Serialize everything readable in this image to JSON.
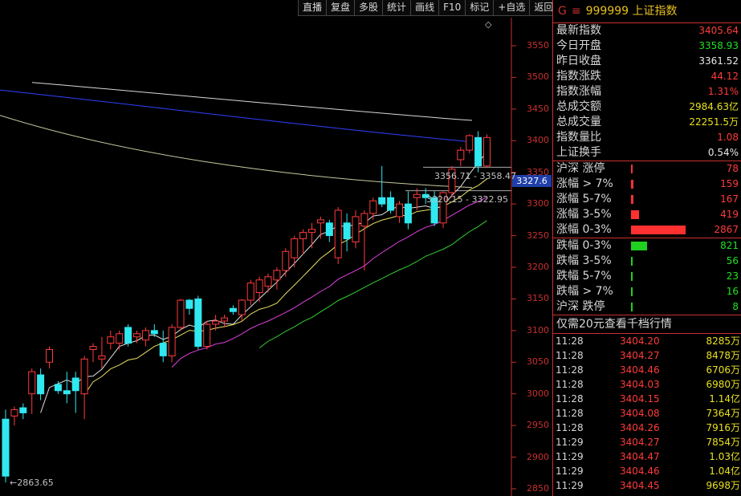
{
  "toolbar": [
    "直播",
    "复盘",
    "多股",
    "统计",
    "画线",
    "F10",
    "标记",
    "+自选",
    "返回"
  ],
  "axis": {
    "ticks": [
      3550,
      3500,
      3450,
      3400,
      3350,
      3300,
      3250,
      3200,
      3150,
      3100,
      3050,
      3000,
      2950,
      2900,
      2850
    ],
    "current_price_tag": "3327.6"
  },
  "annotations": {
    "upper_range": "3356.71 - 3358.47",
    "lower_range": "3320.15 - 3322.95",
    "low_marker": "2863.65"
  },
  "chart_data": {
    "type": "line",
    "candles": [
      {
        "o": 2960,
        "h": 2975,
        "l": 2860,
        "c": 2870
      },
      {
        "o": 2965,
        "h": 2980,
        "l": 2950,
        "c": 2975
      },
      {
        "o": 2978,
        "h": 2985,
        "l": 2960,
        "c": 2970
      },
      {
        "o": 3000,
        "h": 3040,
        "l": 2968,
        "c": 3035
      },
      {
        "o": 3030,
        "h": 3040,
        "l": 2990,
        "c": 3000
      },
      {
        "o": 3050,
        "h": 3075,
        "l": 3040,
        "c": 3070
      },
      {
        "o": 3015,
        "h": 3020,
        "l": 3000,
        "c": 3005
      },
      {
        "o": 3005,
        "h": 3035,
        "l": 2985,
        "c": 3000
      },
      {
        "o": 3025,
        "h": 3035,
        "l": 2970,
        "c": 3005
      },
      {
        "o": 3000,
        "h": 3060,
        "l": 2960,
        "c": 3055
      },
      {
        "o": 3070,
        "h": 3080,
        "l": 3050,
        "c": 3075
      },
      {
        "o": 3055,
        "h": 3090,
        "l": 3040,
        "c": 3060
      },
      {
        "o": 3080,
        "h": 3100,
        "l": 3070,
        "c": 3090
      },
      {
        "o": 3080,
        "h": 3100,
        "l": 3070,
        "c": 3095
      },
      {
        "o": 3105,
        "h": 3110,
        "l": 3075,
        "c": 3080
      },
      {
        "o": 3090,
        "h": 3100,
        "l": 3080,
        "c": 3095
      },
      {
        "o": 3085,
        "h": 3105,
        "l": 3075,
        "c": 3100
      },
      {
        "o": 3100,
        "h": 3110,
        "l": 3090,
        "c": 3095
      },
      {
        "o": 3080,
        "h": 3100,
        "l": 3050,
        "c": 3060
      },
      {
        "o": 3060,
        "h": 3110,
        "l": 3050,
        "c": 3105
      },
      {
        "o": 3105,
        "h": 3150,
        "l": 3100,
        "c": 3148
      },
      {
        "o": 3148,
        "h": 3150,
        "l": 3125,
        "c": 3135
      },
      {
        "o": 3150,
        "h": 3155,
        "l": 3070,
        "c": 3075
      },
      {
        "o": 3075,
        "h": 3115,
        "l": 3070,
        "c": 3110
      },
      {
        "o": 3110,
        "h": 3125,
        "l": 3100,
        "c": 3115
      },
      {
        "o": 3115,
        "h": 3125,
        "l": 3105,
        "c": 3120
      },
      {
        "o": 3135,
        "h": 3140,
        "l": 3125,
        "c": 3130
      },
      {
        "o": 3125,
        "h": 3150,
        "l": 3115,
        "c": 3148
      },
      {
        "o": 3148,
        "h": 3180,
        "l": 3140,
        "c": 3175
      },
      {
        "o": 3160,
        "h": 3185,
        "l": 3145,
        "c": 3180
      },
      {
        "o": 3170,
        "h": 3190,
        "l": 3160,
        "c": 3185
      },
      {
        "o": 3180,
        "h": 3200,
        "l": 3165,
        "c": 3195
      },
      {
        "o": 3195,
        "h": 3230,
        "l": 3185,
        "c": 3225
      },
      {
        "o": 3215,
        "h": 3250,
        "l": 3200,
        "c": 3245
      },
      {
        "o": 3245,
        "h": 3260,
        "l": 3220,
        "c": 3255
      },
      {
        "o": 3255,
        "h": 3270,
        "l": 3230,
        "c": 3260
      },
      {
        "o": 3270,
        "h": 3280,
        "l": 3245,
        "c": 3275
      },
      {
        "o": 3270,
        "h": 3275,
        "l": 3240,
        "c": 3250
      },
      {
        "o": 3215,
        "h": 3295,
        "l": 3205,
        "c": 3290
      },
      {
        "o": 3270,
        "h": 3285,
        "l": 3225,
        "c": 3245
      },
      {
        "o": 3240,
        "h": 3290,
        "l": 3230,
        "c": 3280
      },
      {
        "o": 3265,
        "h": 3290,
        "l": 3195,
        "c": 3285
      },
      {
        "o": 3285,
        "h": 3310,
        "l": 3275,
        "c": 3305
      },
      {
        "o": 3310,
        "h": 3360,
        "l": 3295,
        "c": 3300
      },
      {
        "o": 3310,
        "h": 3320,
        "l": 3285,
        "c": 3290
      },
      {
        "o": 3280,
        "h": 3305,
        "l": 3270,
        "c": 3300
      },
      {
        "o": 3300,
        "h": 3320,
        "l": 3260,
        "c": 3270
      },
      {
        "o": 3310,
        "h": 3325,
        "l": 3290,
        "c": 3315
      },
      {
        "o": 3315,
        "h": 3325,
        "l": 3300,
        "c": 3310
      },
      {
        "o": 3310,
        "h": 3320,
        "l": 3265,
        "c": 3270
      },
      {
        "o": 3270,
        "h": 3320,
        "l": 3262,
        "c": 3318
      },
      {
        "o": 3318,
        "h": 3360,
        "l": 3310,
        "c": 3355
      },
      {
        "o": 3370,
        "h": 3390,
        "l": 3360,
        "c": 3385
      },
      {
        "o": 3385,
        "h": 3410,
        "l": 3380,
        "c": 3408
      },
      {
        "o": 3405,
        "h": 3415,
        "l": 3350,
        "c": 3360
      },
      {
        "o": 3360,
        "h": 3410,
        "l": 3358,
        "c": 3405
      }
    ]
  },
  "panel": {
    "code_prefix": "G",
    "code_sym": "≡",
    "code": "999999",
    "name": "上证指数",
    "quote": [
      {
        "label": "最新指数",
        "value": "3405.64",
        "color": "red"
      },
      {
        "label": "今日开盘",
        "value": "3358.93",
        "color": "grn"
      },
      {
        "label": "昨日收盘",
        "value": "3361.52",
        "color": "wht"
      },
      {
        "label": "指数涨跌",
        "value": "44.12",
        "color": "red"
      },
      {
        "label": "指数涨幅",
        "value": "1.31%",
        "color": "red"
      },
      {
        "label": "总成交额",
        "value": "2984.63亿",
        "color": "yel"
      },
      {
        "label": "总成交量",
        "value": "22251.5万",
        "color": "yel"
      },
      {
        "label": "指数量比",
        "value": "1.08",
        "color": "red"
      },
      {
        "label": "上证换手",
        "value": "0.54%",
        "color": "wht"
      }
    ],
    "rise": [
      {
        "label": "沪深 涨停",
        "count": "78",
        "frac": 0.02
      },
      {
        "label": "涨幅 > 7%",
        "count": "159",
        "frac": 0.04
      },
      {
        "label": "涨幅 5-7%",
        "count": "167",
        "frac": 0.04
      },
      {
        "label": "涨幅 3-5%",
        "count": "419",
        "frac": 0.12
      },
      {
        "label": "涨幅 0-3%",
        "count": "2867",
        "frac": 0.8
      }
    ],
    "fall": [
      {
        "label": "跌幅 0-3%",
        "count": "821",
        "frac": 0.23
      },
      {
        "label": "跌幅 3-5%",
        "count": "56",
        "frac": 0.01
      },
      {
        "label": "跌幅 5-7%",
        "count": "23",
        "frac": 0.01
      },
      {
        "label": "跌幅 > 7%",
        "count": "16",
        "frac": 0.01
      },
      {
        "label": "沪深 跌停",
        "count": "8",
        "frac": 0.01
      }
    ],
    "notice": "仅需20元查看千档行情",
    "ticks": [
      {
        "time": "11:28",
        "price": "3404.20",
        "vol": "8285",
        "unit": "万"
      },
      {
        "time": "11:28",
        "price": "3404.27",
        "vol": "8478",
        "unit": "万"
      },
      {
        "time": "11:28",
        "price": "3404.46",
        "vol": "6706",
        "unit": "万"
      },
      {
        "time": "11:28",
        "price": "3404.03",
        "vol": "6980",
        "unit": "万"
      },
      {
        "time": "11:28",
        "price": "3404.15",
        "vol": "1.14",
        "unit": "亿"
      },
      {
        "time": "11:28",
        "price": "3404.08",
        "vol": "7364",
        "unit": "万"
      },
      {
        "time": "11:28",
        "price": "3404.26",
        "vol": "7916",
        "unit": "万"
      },
      {
        "time": "11:29",
        "price": "3404.27",
        "vol": "7854",
        "unit": "万"
      },
      {
        "time": "11:29",
        "price": "3404.47",
        "vol": "1.03",
        "unit": "亿"
      },
      {
        "time": "11:29",
        "price": "3404.46",
        "vol": "1.04",
        "unit": "亿"
      },
      {
        "time": "11:29",
        "price": "3404.45",
        "vol": "9698",
        "unit": "万"
      }
    ]
  }
}
